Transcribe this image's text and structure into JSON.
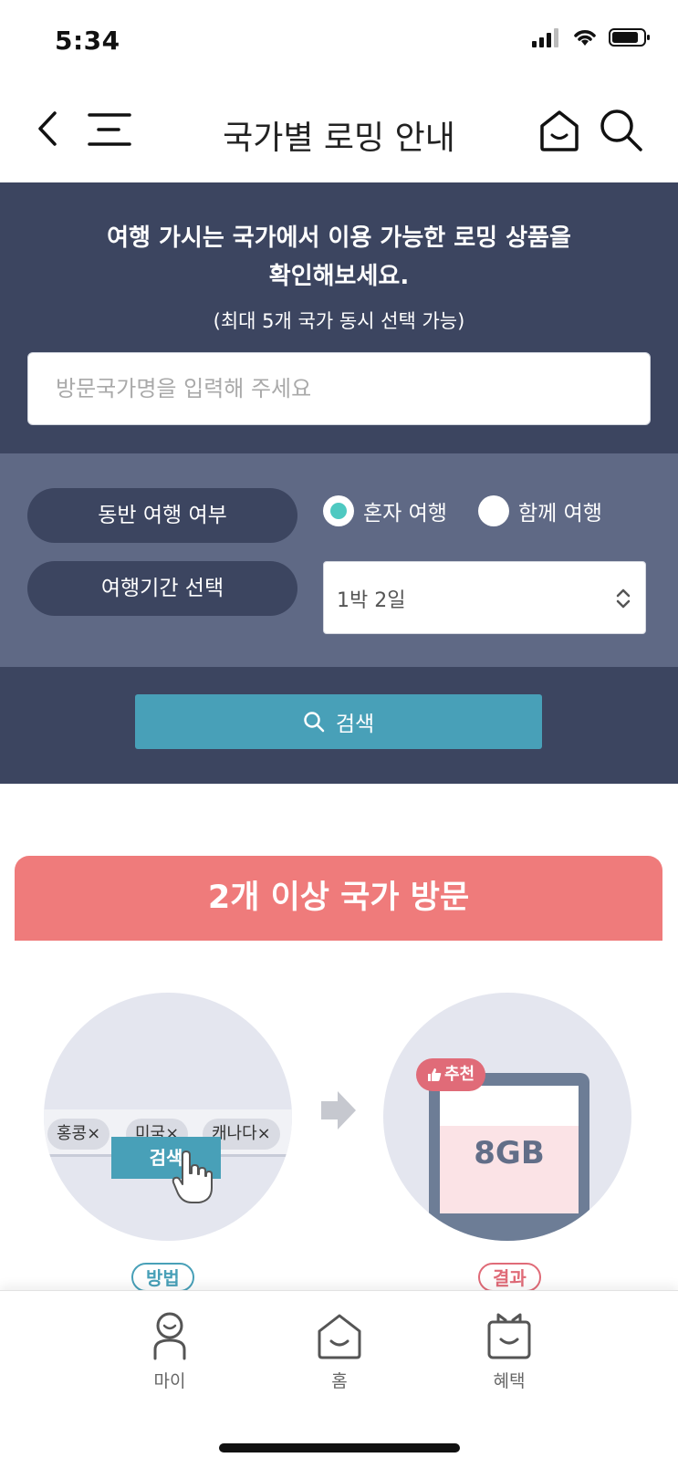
{
  "status_bar": {
    "time": "5:34"
  },
  "header": {
    "title": "국가별 로밍 안내",
    "back_icon": "chevron-left-icon",
    "menu_icon": "menu-icon",
    "home_icon": "home-icon",
    "search_icon": "search-icon"
  },
  "search_panel": {
    "headline_line1": "여행 가시는 국가에서 이용 가능한 로밍 상품을",
    "headline_line2": "확인해보세요.",
    "subnote": "(최대 5개 국가 동시 선택 가능)",
    "country_input": {
      "placeholder": "방문국가명을 입력해 주세요",
      "value": ""
    },
    "companion": {
      "label": "동반 여행 여부",
      "options": [
        {
          "label": "혼자 여행",
          "selected": true
        },
        {
          "label": "함께 여행",
          "selected": false
        }
      ]
    },
    "period": {
      "label": "여행기간 선택",
      "value": "1박 2일"
    },
    "search_button": "검색"
  },
  "multi_country": {
    "banner": "2개 이상 국가 방문",
    "tags": [
      "홍콩×",
      "미국×",
      "캐나다×"
    ],
    "illustration_search": "검색",
    "recommend_badge": "추천",
    "result_value": "8GB",
    "step_method": "방법",
    "step_result": "결과"
  },
  "tabbar": {
    "items": [
      {
        "label": "마이",
        "icon": "person-icon"
      },
      {
        "label": "홈",
        "icon": "home-icon"
      },
      {
        "label": "혜택",
        "icon": "gift-icon"
      }
    ]
  },
  "colors": {
    "panel_dark": "#3c4560",
    "panel_mid": "#5f6985",
    "accent_teal": "#48a0b8",
    "radio_on": "#4ec9c1",
    "banner_coral": "#ef7b7b"
  }
}
